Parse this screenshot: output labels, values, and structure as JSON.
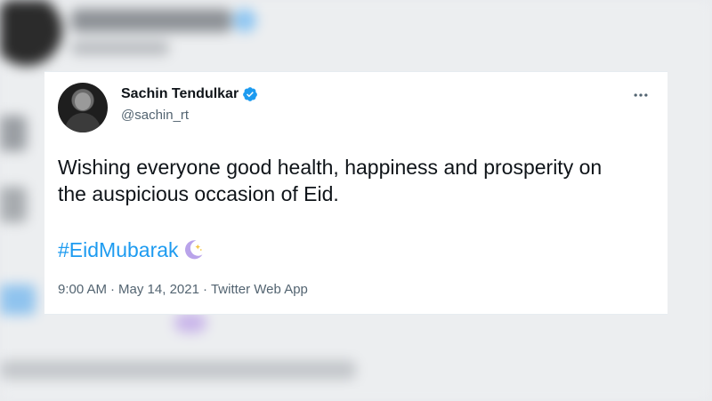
{
  "tweet": {
    "author_name": "Sachin Tendulkar",
    "handle": "@sachin_rt",
    "text": "Wishing everyone good health, happiness and prosperity on the auspicious occasion of Eid.",
    "hashtag": "#EidMubarak",
    "emoji": "crescent-moon-icon",
    "time": "9:00 AM",
    "separator": "·",
    "date": "May 14, 2021",
    "source": "Twitter Web App"
  },
  "colors": {
    "link": "#1d9bf0",
    "verified": "#1d9bf0",
    "text": "#0f1419",
    "muted": "#536471"
  }
}
